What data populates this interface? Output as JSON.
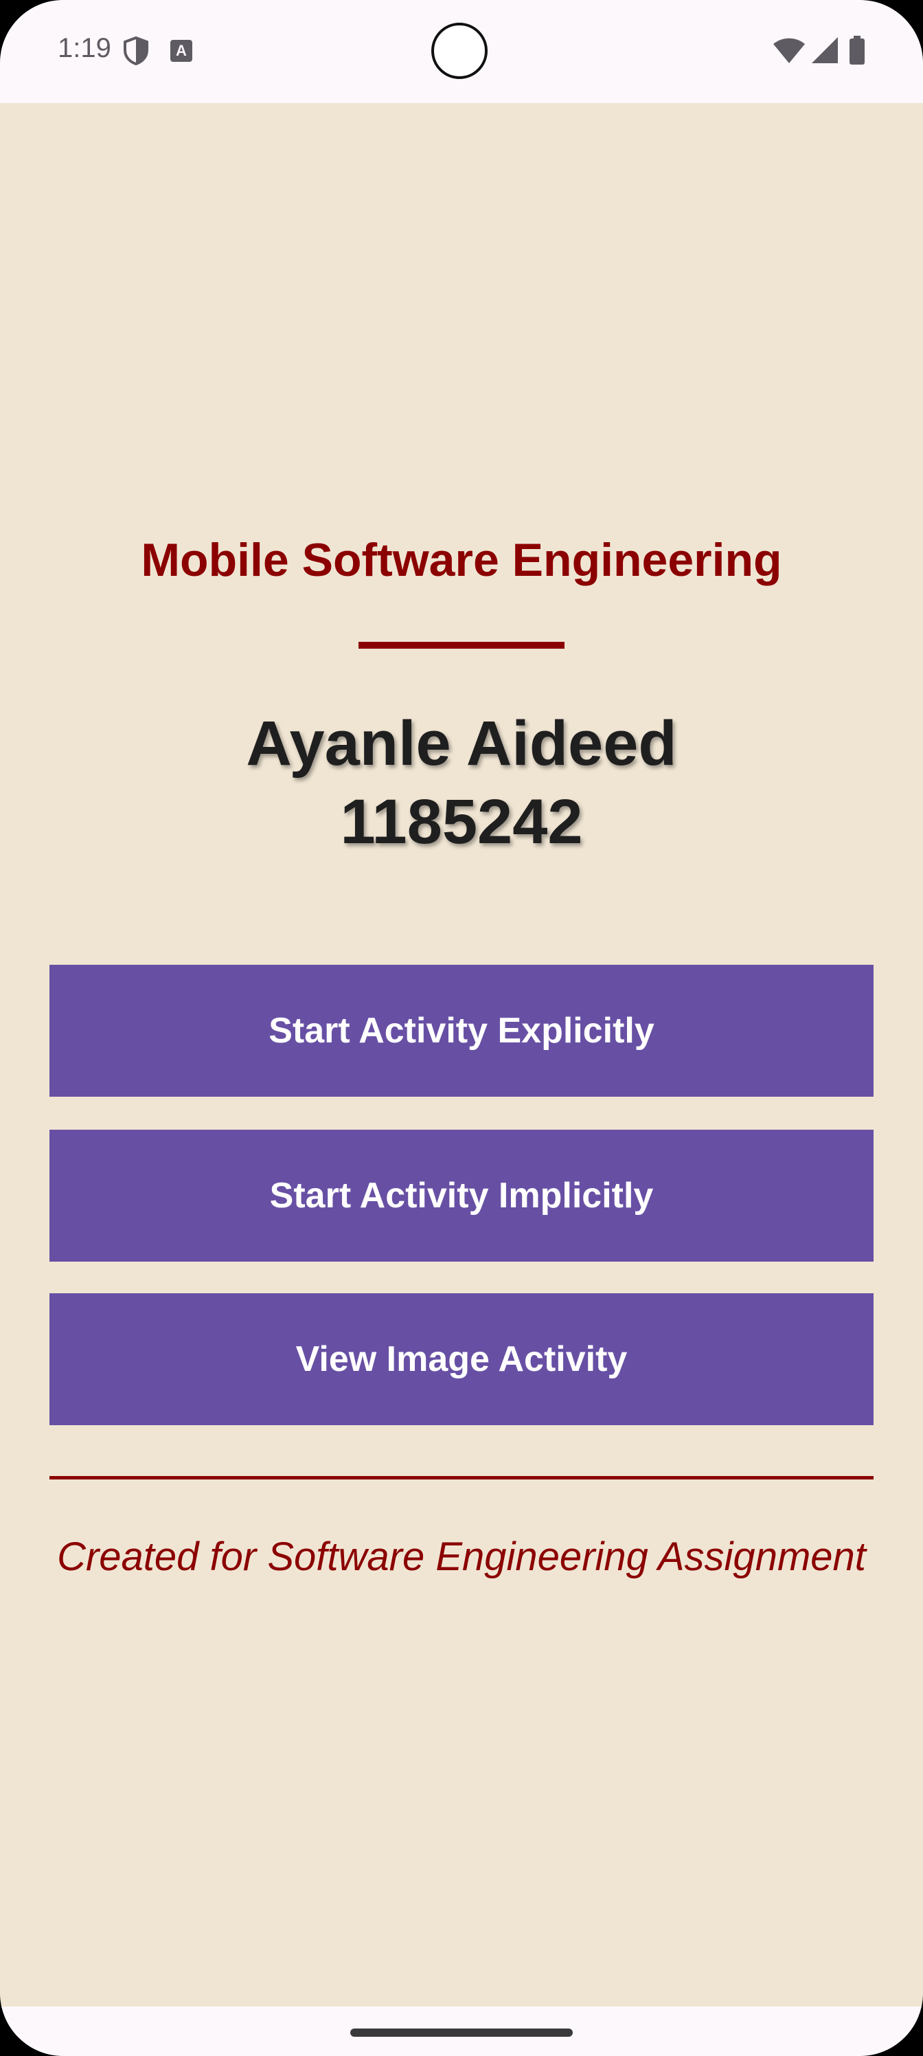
{
  "status_bar": {
    "time": "1:19",
    "icons": [
      "shield-icon",
      "keyboard-a-icon",
      "wifi-icon",
      "signal-icon",
      "battery-icon"
    ],
    "keyboard_glyph": "A"
  },
  "main": {
    "course_title": "Mobile Software Engineering",
    "student_name": "Ayanle Aideed",
    "student_id": "1185242",
    "buttons": [
      {
        "label": "Start Activity Explicitly"
      },
      {
        "label": "Start Activity Implicitly"
      },
      {
        "label": "View Image Activity"
      }
    ],
    "footer": "Created for Software Engineering Assignment"
  },
  "colors": {
    "background": "#f0e5d3",
    "accent": "#8b0000",
    "button": "#6750a4",
    "button_text": "#ffffff",
    "system_bar": "#fdf8fc"
  }
}
